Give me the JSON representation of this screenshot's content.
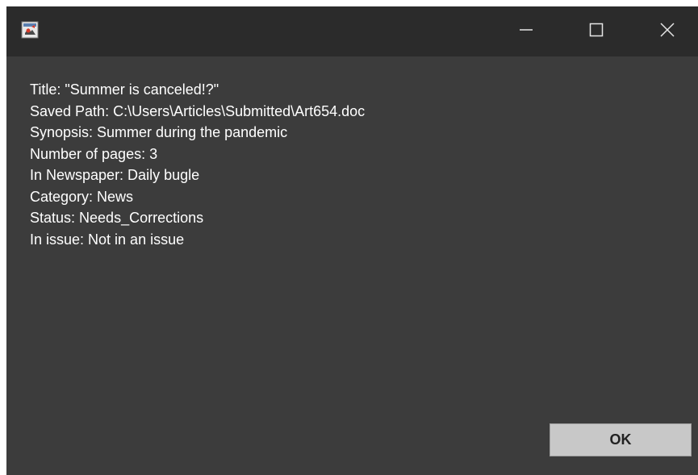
{
  "window": {
    "icon": "java-app-icon",
    "controls": {
      "minimize_icon": "minimize-icon",
      "maximize_icon": "maximize-icon",
      "close_icon": "close-icon"
    }
  },
  "details": [
    "Title: \"Summer is canceled!?\"",
    "Saved Path: C:\\Users\\Articles\\Submitted\\Art654.doc",
    "Synopsis: Summer during the pandemic",
    "Number of pages: 3",
    "In Newspaper: Daily bugle",
    "Category: News",
    "Status: Needs_Corrections",
    "In issue: Not in an issue"
  ],
  "buttons": {
    "ok_label": "OK"
  },
  "colors": {
    "window_bg": "#3c3c3c",
    "titlebar_bg": "#2b2b2b",
    "text": "#ffffff",
    "button_bg": "#c8c8c8"
  }
}
